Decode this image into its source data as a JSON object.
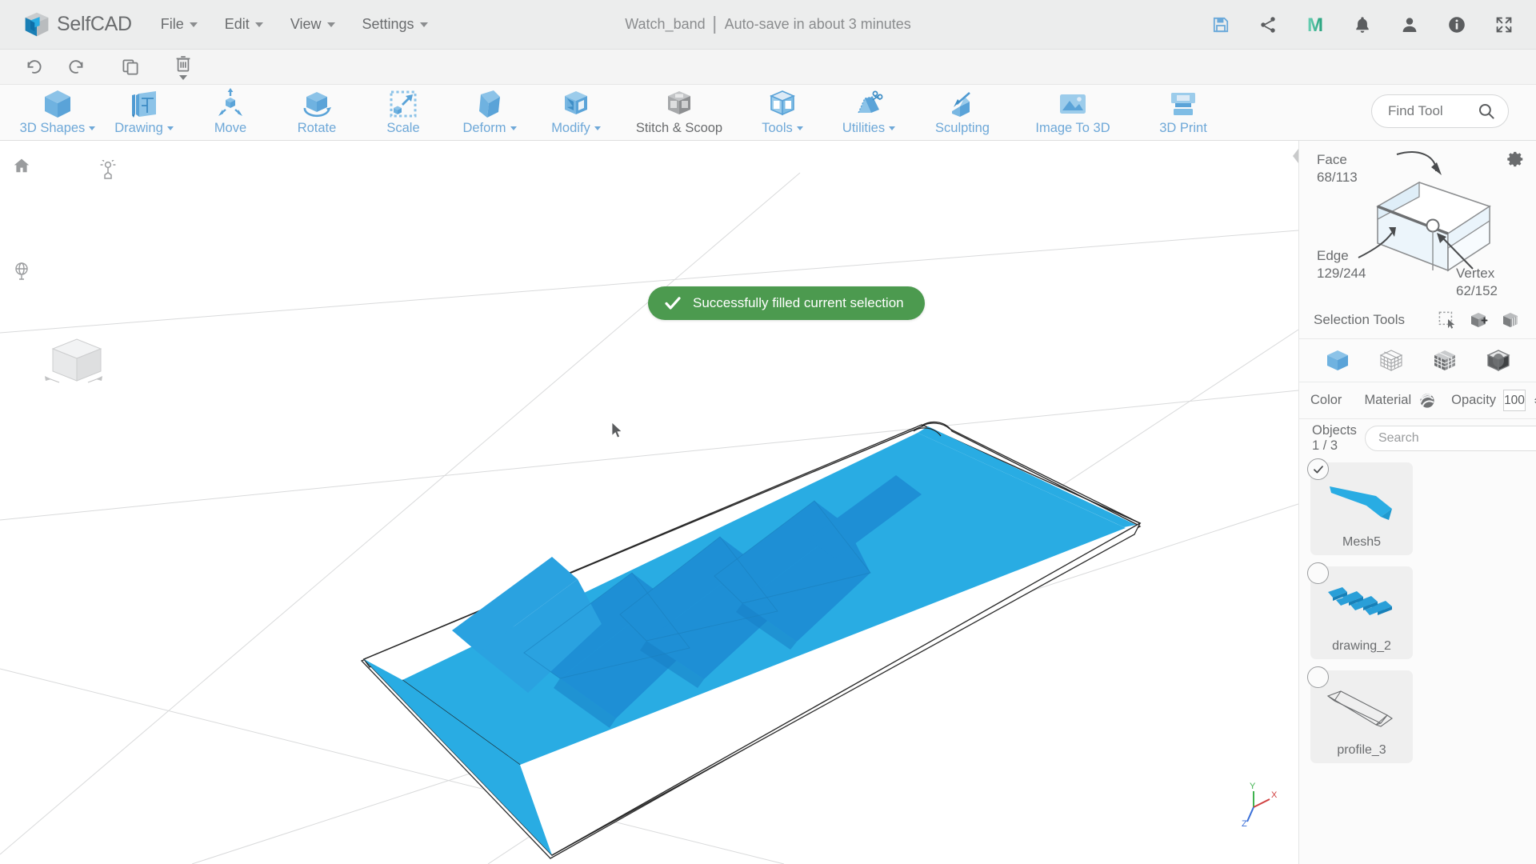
{
  "app": {
    "brand": "SelfCAD",
    "menus": [
      {
        "label": "File",
        "caret": true
      },
      {
        "label": "Edit",
        "caret": true
      },
      {
        "label": "View",
        "caret": true
      },
      {
        "label": "Settings",
        "caret": true
      }
    ],
    "document_title": "Watch_band",
    "autosave_text": "Auto-save in about 3 minutes",
    "top_actions": [
      {
        "name": "save-icon",
        "title": "Save"
      },
      {
        "name": "share-icon",
        "title": "Share"
      },
      {
        "name": "m-logo-icon",
        "title": "M"
      },
      {
        "name": "notifications-bell-icon",
        "title": "Notifications"
      },
      {
        "name": "user-account-icon",
        "title": "Account"
      },
      {
        "name": "info-icon",
        "title": "Info"
      },
      {
        "name": "fullscreen-icon",
        "title": "Fullscreen"
      }
    ]
  },
  "edit_row": [
    {
      "name": "undo-button",
      "title": "Undo"
    },
    {
      "name": "redo-button",
      "title": "Redo"
    },
    {
      "name": "copy-button",
      "title": "Copy"
    },
    {
      "name": "delete-button",
      "title": "Delete"
    }
  ],
  "toolbar": {
    "tools": [
      {
        "label": "3D Shapes",
        "caret": true,
        "icon": "cube-icon",
        "disabled": false
      },
      {
        "label": "Drawing",
        "caret": true,
        "icon": "drawing-icon",
        "disabled": false
      },
      {
        "label": "Move",
        "caret": false,
        "icon": "move-icon",
        "disabled": false
      },
      {
        "label": "Rotate",
        "caret": false,
        "icon": "rotate-icon",
        "disabled": false
      },
      {
        "label": "Scale",
        "caret": false,
        "icon": "scale-icon",
        "disabled": false
      },
      {
        "label": "Deform",
        "caret": true,
        "icon": "deform-icon",
        "disabled": false
      },
      {
        "label": "Modify",
        "caret": true,
        "icon": "modify-icon",
        "disabled": false
      },
      {
        "label": "Stitch & Scoop",
        "caret": false,
        "icon": "stitch-scoop-icon",
        "disabled": true
      },
      {
        "label": "Tools",
        "caret": true,
        "icon": "tools-icon",
        "disabled": false
      },
      {
        "label": "Utilities",
        "caret": true,
        "icon": "utilities-icon",
        "disabled": false
      },
      {
        "label": "Sculpting",
        "caret": false,
        "icon": "sculpting-icon",
        "disabled": false
      },
      {
        "label": "Image To 3D",
        "caret": false,
        "icon": "image-to-3d-icon",
        "disabled": false
      },
      {
        "label": "3D Print",
        "caret": false,
        "icon": "3d-print-icon",
        "disabled": false
      }
    ],
    "find_tool_label": "Find Tool"
  },
  "viewport": {
    "toast": {
      "message": "Successfully filled current selection",
      "color": "#4c9a4f",
      "icon": "check-icon"
    },
    "left_icons": [
      {
        "name": "home-view-icon"
      },
      {
        "name": "lighting-icon"
      },
      {
        "name": "globe-orbit-icon"
      }
    ],
    "axis_labels": {
      "x": "X",
      "y": "Y",
      "z": "Z"
    },
    "model_color": "#29ace3"
  },
  "right_panel": {
    "settings_gear": "gear-icon",
    "selection": {
      "face": {
        "label": "Face",
        "value": "68/113"
      },
      "edge": {
        "label": "Edge",
        "value": "129/244"
      },
      "vertex": {
        "label": "Vertex",
        "value": "62/152"
      }
    },
    "selection_tools": {
      "label": "Selection Tools",
      "tools": [
        {
          "name": "rect-select-icon"
        },
        {
          "name": "add-selection-icon"
        },
        {
          "name": "loop-selection-icon"
        }
      ]
    },
    "modes": [
      {
        "name": "object-mode-icon"
      },
      {
        "name": "vertex-mode-icon"
      },
      {
        "name": "face-mode-icon"
      },
      {
        "name": "polygon-mode-icon"
      }
    ],
    "material": {
      "color_label": "Color",
      "color_value": "#29ace3",
      "material_label": "Material",
      "opacity_label": "Opacity",
      "opacity_value": "100"
    },
    "objects": {
      "count_label": "Objects 1 / 3",
      "search_placeholder": "Search",
      "search_value": "",
      "items": [
        {
          "name": "Mesh5",
          "selected": true,
          "thumb": "mesh-band"
        },
        {
          "name": "drawing_2",
          "selected": false,
          "thumb": "drawing-pieces"
        },
        {
          "name": "profile_3",
          "selected": false,
          "thumb": "wireframe-profile"
        }
      ]
    }
  }
}
